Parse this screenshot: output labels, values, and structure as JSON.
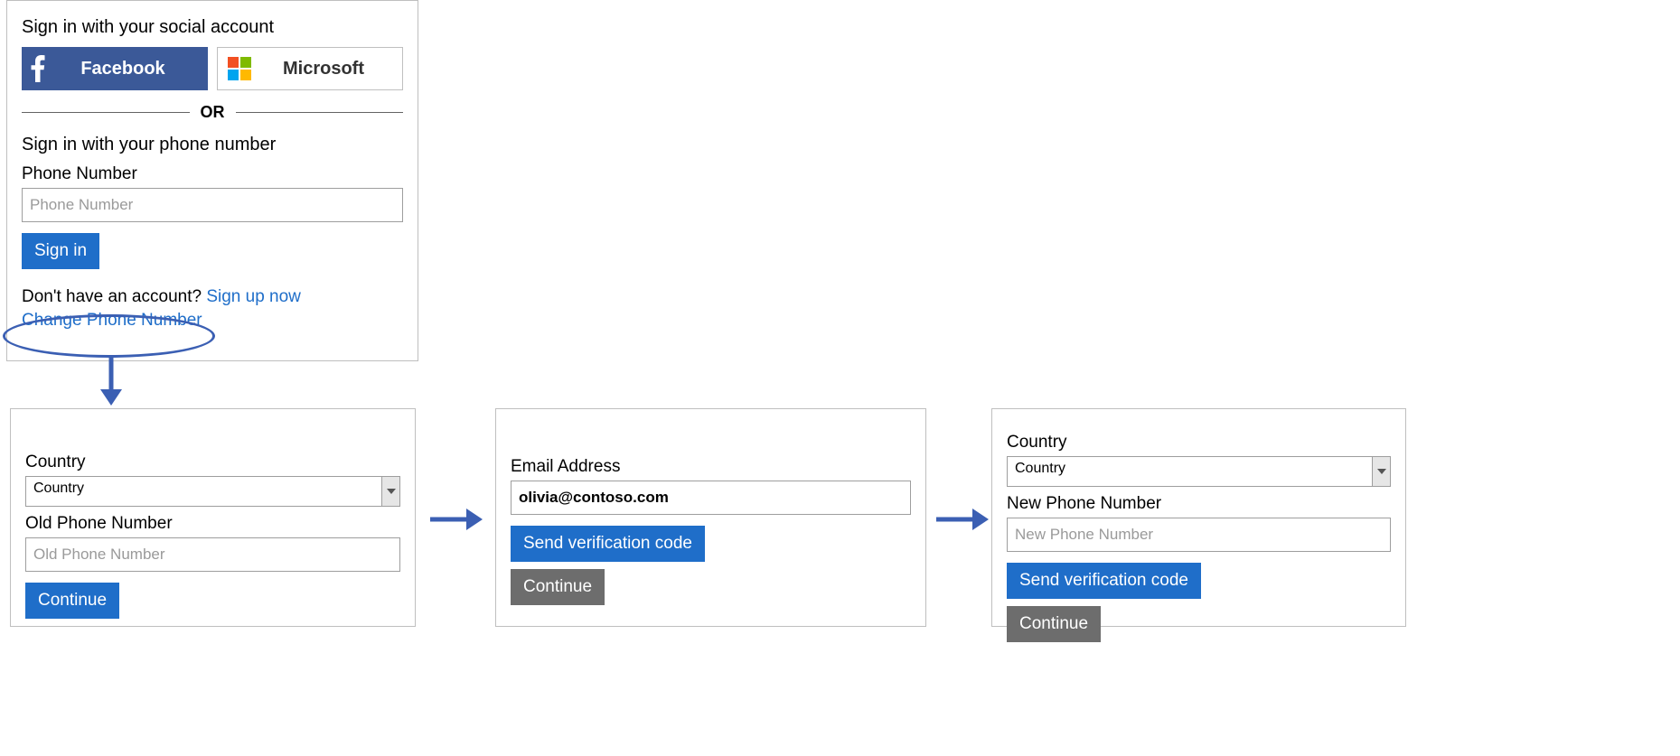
{
  "signin": {
    "social_heading": "Sign in with your social account",
    "facebook_label": "Facebook",
    "microsoft_label": "Microsoft",
    "or_text": "OR",
    "phone_heading": "Sign in with your phone number",
    "phone_label": "Phone Number",
    "phone_placeholder": "Phone Number",
    "signin_button": "Sign in",
    "no_account_text": "Don't have an account? ",
    "signup_link": "Sign up now",
    "change_phone_link": "Change Phone Number"
  },
  "step1": {
    "country_label": "Country",
    "country_value": "Country",
    "old_phone_label": "Old Phone Number",
    "old_phone_placeholder": "Old Phone Number",
    "continue_button": "Continue"
  },
  "step2": {
    "email_label": "Email Address",
    "email_value": "olivia@contoso.com",
    "send_code_button": "Send verification code",
    "continue_button": "Continue"
  },
  "step3": {
    "country_label": "Country",
    "country_value": "Country",
    "new_phone_label": "New Phone Number",
    "new_phone_placeholder": "New Phone Number",
    "send_code_button": "Send verification code",
    "continue_button": "Continue"
  },
  "colors": {
    "primary": "#1f6ec9",
    "facebook": "#3b5998",
    "gray_button": "#6d6d6d",
    "annotation": "#3b5fb3",
    "ms_red": "#f25022",
    "ms_green": "#7fba00",
    "ms_blue": "#00a4ef",
    "ms_yellow": "#ffb900"
  }
}
